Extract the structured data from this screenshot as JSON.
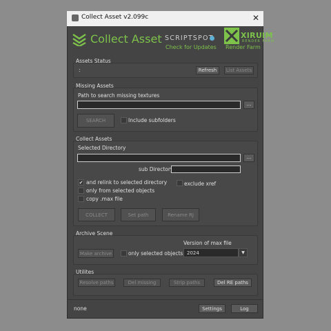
{
  "window": {
    "title": "Collect Asset v2.099c",
    "close_glyph": "✕"
  },
  "header": {
    "logo_text": "Collect Asset",
    "scriptspot": {
      "name": "SCRIPTSPOT",
      "link": "Check for Updates"
    },
    "xiruim": {
      "name": "XIRUIM",
      "tagline": "RENDER FARM",
      "link": "Render Farm"
    }
  },
  "assets_status": {
    "title": "Assets Status",
    "status": ":",
    "refresh_label": "Refresh",
    "list_assets_label": "List Assets"
  },
  "missing_assets": {
    "title": "Missing Assets",
    "path_label": "Path to search missing textures",
    "path_value": "",
    "browse_label": "...",
    "search_label": "SEARCH",
    "include_subfolders_label": "Include subfolders",
    "include_subfolders_checked": false
  },
  "collect_assets": {
    "title": "Collect Assets",
    "dir_label": "Selected Directory",
    "dir_value": "",
    "browse_label": "...",
    "subdir_label": "sub Directory",
    "subdir_value": "",
    "relink_label": "and relink to selected directory",
    "relink_checked": true,
    "exclude_xref_label": "exclude xref",
    "exclude_xref_checked": false,
    "only_selected_label": "only from selected objects",
    "only_selected_checked": false,
    "copy_max_label": "copy .max file",
    "copy_max_checked": false,
    "collect_label": "COLLECT",
    "set_path_label": "Set path",
    "rename_label": "Rename RJ"
  },
  "archive_scene": {
    "title": "Archive Scene",
    "make_archive_label": "Make archive",
    "only_selected_label": "only selected objects",
    "only_selected_checked": false,
    "version_label": "Version of max file",
    "version_value": "2024",
    "dropdown_glyph": "▼"
  },
  "utilities": {
    "title": "Utilites",
    "resolve_label": "Resolve paths",
    "del_missing_label": "Del missing",
    "strip_label": "Strip paths",
    "del_re_label": "Del RE paths"
  },
  "footer": {
    "status_text": "none",
    "settings_label": "Settings",
    "log_label": "Log"
  },
  "colors": {
    "accent_green": "#7dc24b",
    "panel_bg": "#444444",
    "titlebar_bg": "#f0f0f0"
  }
}
